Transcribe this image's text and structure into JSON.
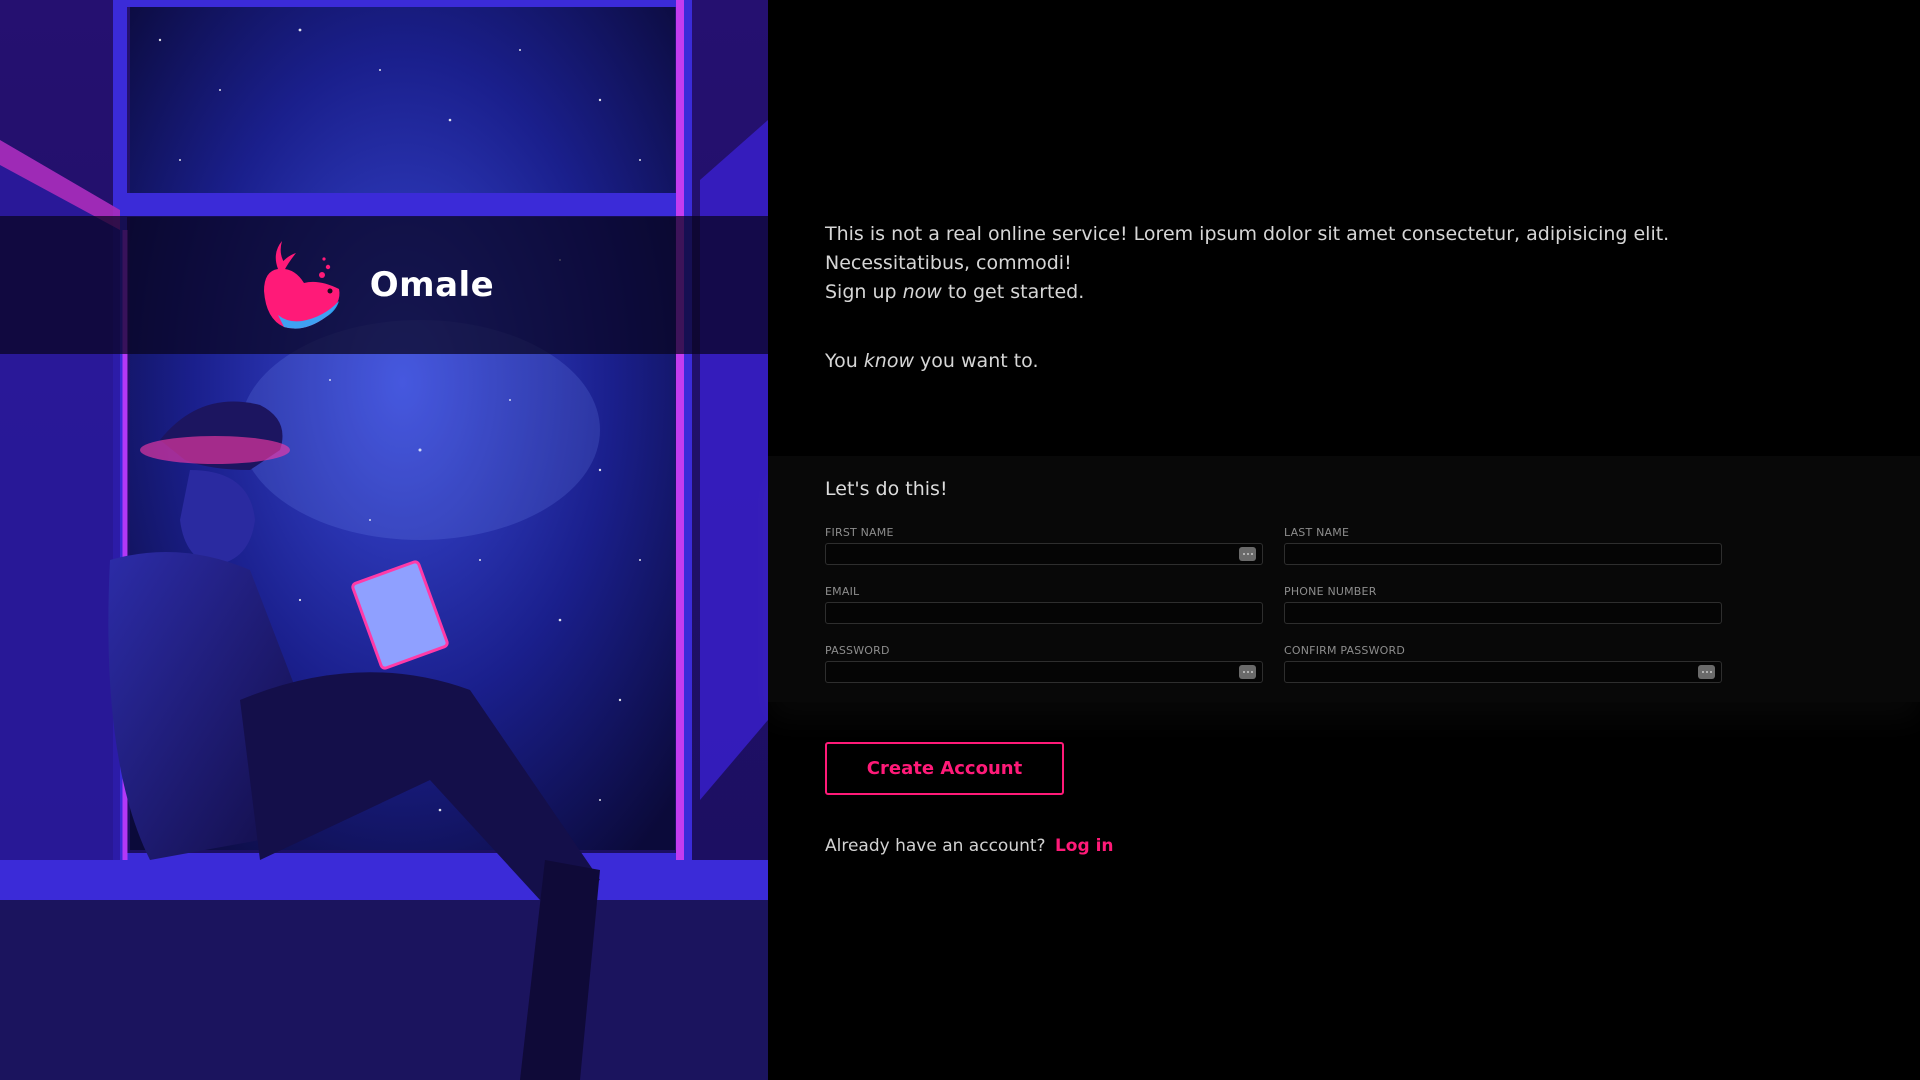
{
  "brand": {
    "name": "Omale",
    "logo_icon": "whale-logo-icon",
    "accent": "#ff1a78"
  },
  "intro": {
    "line1": "This is not a real online service! Lorem ipsum dolor sit amet consectetur, adipisicing elit.",
    "line2": "Necessitatibus, commodi!",
    "line3_pre": "Sign up ",
    "line3_em": "now",
    "line3_post": " to get started.",
    "line4_pre": "You ",
    "line4_em": "know",
    "line4_post": " you want to."
  },
  "form": {
    "title": "Let's do this!",
    "fields": {
      "first_name": {
        "label": "FIRST NAME",
        "value": "",
        "icon": "password-manager-icon"
      },
      "last_name": {
        "label": "LAST NAME",
        "value": ""
      },
      "email": {
        "label": "EMAIL",
        "value": ""
      },
      "phone": {
        "label": "PHONE NUMBER",
        "value": ""
      },
      "password": {
        "label": "PASSWORD",
        "value": "",
        "icon": "password-manager-icon"
      },
      "confirm_password": {
        "label": "CONFIRM PASSWORD",
        "value": "",
        "icon": "password-manager-icon"
      }
    }
  },
  "actions": {
    "create_label": "Create Account",
    "login_prompt": "Already have an account?",
    "login_link": "Log in"
  }
}
